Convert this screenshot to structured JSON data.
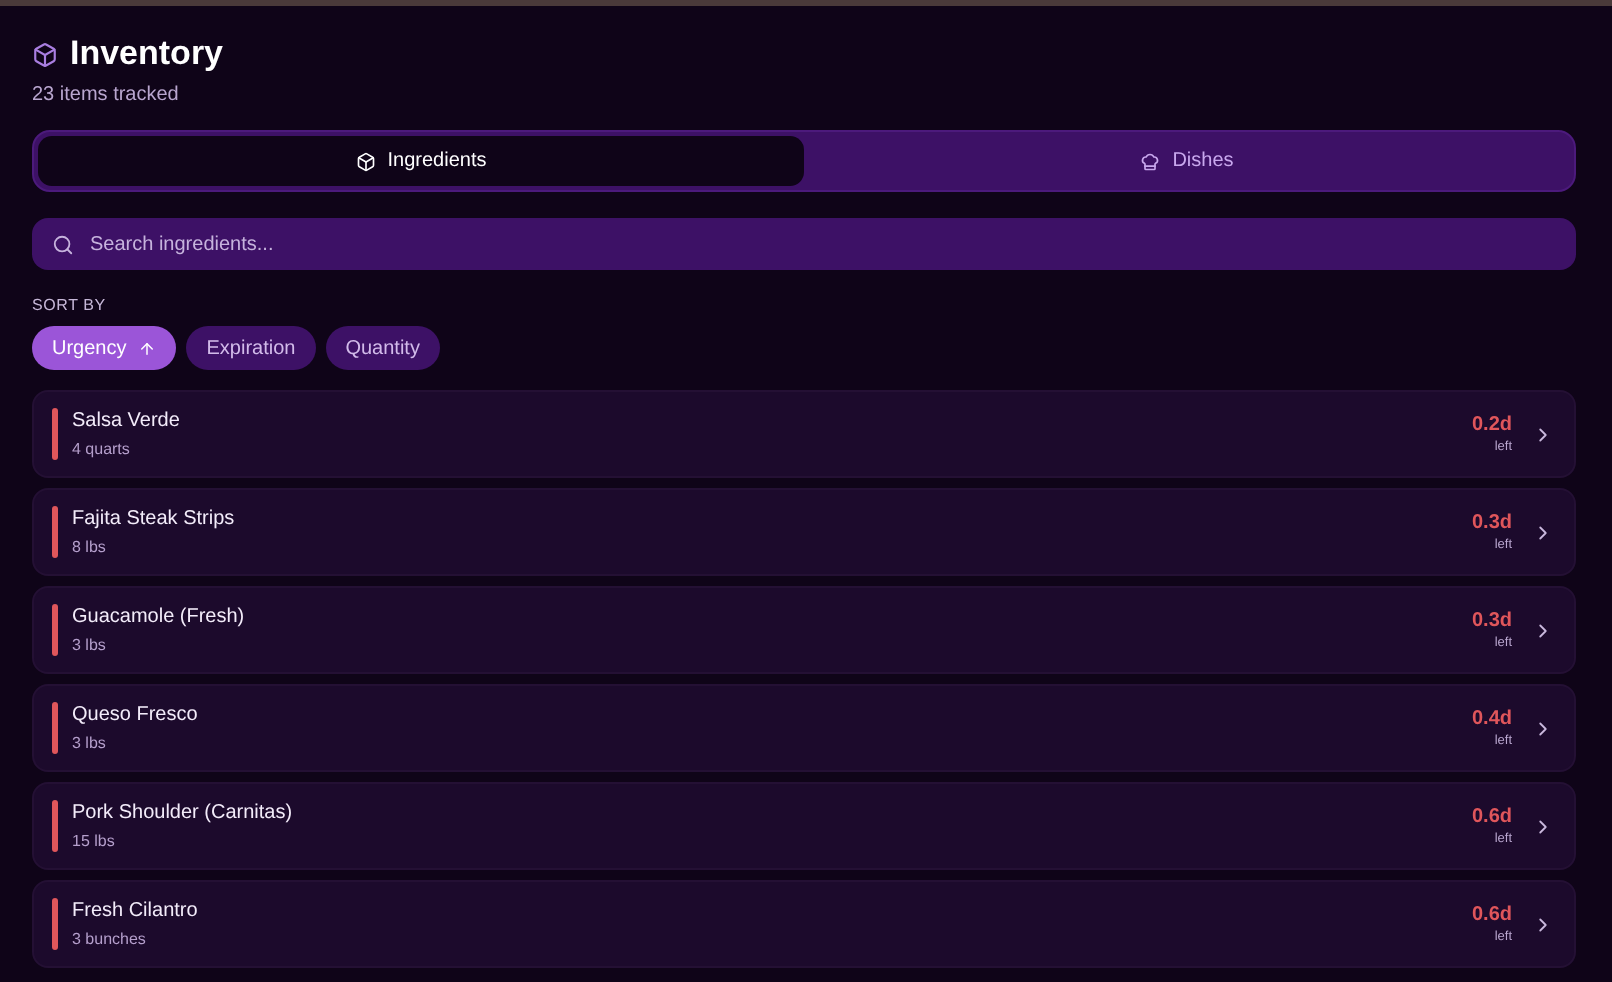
{
  "header": {
    "title": "Inventory",
    "subtitle": "23 items tracked"
  },
  "tabs": [
    {
      "label": "Ingredients",
      "kind": "box",
      "selected": true
    },
    {
      "label": "Dishes",
      "kind": "chef",
      "selected": false
    }
  ],
  "search": {
    "placeholder": "Search ingredients..."
  },
  "sort": {
    "label": "SORT BY",
    "options": [
      {
        "label": "Urgency",
        "selected": true,
        "ascending": true
      },
      {
        "label": "Expiration",
        "selected": false
      },
      {
        "label": "Quantity",
        "selected": false
      }
    ]
  },
  "items": [
    {
      "name": "Salsa Verde",
      "quantity": "4 quarts",
      "remaining": "0.2d",
      "remaining_label": "left",
      "color": "#e0565b"
    },
    {
      "name": "Fajita Steak Strips",
      "quantity": "8 lbs",
      "remaining": "0.3d",
      "remaining_label": "left",
      "color": "#e0565b"
    },
    {
      "name": "Guacamole (Fresh)",
      "quantity": "3 lbs",
      "remaining": "0.3d",
      "remaining_label": "left",
      "color": "#e0565b"
    },
    {
      "name": "Queso Fresco",
      "quantity": "3 lbs",
      "remaining": "0.4d",
      "remaining_label": "left",
      "color": "#e0565b"
    },
    {
      "name": "Pork Shoulder (Carnitas)",
      "quantity": "15 lbs",
      "remaining": "0.6d",
      "remaining_label": "left",
      "color": "#e0565b"
    },
    {
      "name": "Fresh Cilantro",
      "quantity": "3 bunches",
      "remaining": "0.6d",
      "remaining_label": "left",
      "color": "#e0565b"
    }
  ]
}
